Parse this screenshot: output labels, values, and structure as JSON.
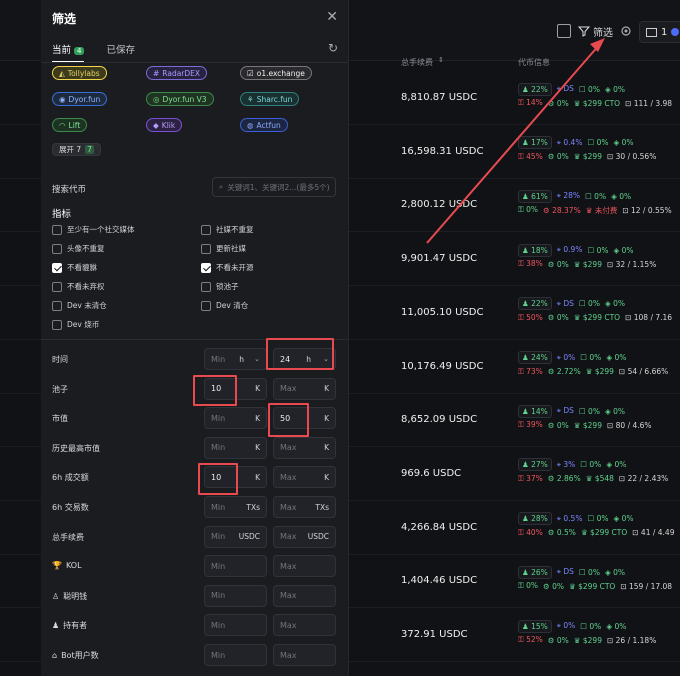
{
  "topbar": {
    "filter_label": "筛选",
    "folder_count": "1"
  },
  "table": {
    "col_fee": "总手续费",
    "col_info": "代币信息"
  },
  "rows": [
    {
      "fee": "8,810.87 USDC",
      "l1": [
        "22%",
        "DS",
        "0%",
        "0%"
      ],
      "l2": [
        "14%",
        "0%",
        "$299 CTO",
        "111 / 3.98"
      ]
    },
    {
      "fee": "16,598.31 USDC",
      "l1": [
        "17%",
        "0.4%",
        "0%",
        "0%"
      ],
      "l2": [
        "45%",
        "0%",
        "$299",
        "30 / 0.56%"
      ]
    },
    {
      "fee": "2,800.12 USDC",
      "l1": [
        "61%",
        "28%",
        "0%",
        "0%"
      ],
      "l2": [
        "0%",
        "28.37%",
        "未付费",
        "12 / 0.55%"
      ]
    },
    {
      "fee": "9,901.47 USDC",
      "l1": [
        "18%",
        "0.9%",
        "0%",
        "0%"
      ],
      "l2": [
        "38%",
        "0%",
        "$299",
        "32 / 1.15%"
      ]
    },
    {
      "fee": "11,005.10 USDC",
      "l1": [
        "22%",
        "DS",
        "0%",
        "0%"
      ],
      "l2": [
        "50%",
        "0%",
        "$299 CTO",
        "108 / 7.16"
      ]
    },
    {
      "fee": "10,176.49 USDC",
      "l1": [
        "24%",
        "0%",
        "0%",
        "0%"
      ],
      "l2": [
        "73%",
        "2.72%",
        "$299",
        "54 / 6.66%"
      ]
    },
    {
      "fee": "8,652.09 USDC",
      "l1": [
        "14%",
        "DS",
        "0%",
        "0%"
      ],
      "l2": [
        "39%",
        "0%",
        "$299",
        "80 / 4.6%"
      ]
    },
    {
      "fee": "969.6 USDC",
      "l1": [
        "27%",
        "3%",
        "0%",
        "0%"
      ],
      "l2": [
        "37%",
        "2.86%",
        "$548",
        "22 / 2.43%"
      ]
    },
    {
      "fee": "4,266.84 USDC",
      "l1": [
        "28%",
        "0.5%",
        "0%",
        "0%"
      ],
      "l2": [
        "40%",
        "0.5%",
        "$299 CTO",
        "41 / 4.49"
      ]
    },
    {
      "fee": "1,404.46 USDC",
      "l1": [
        "26%",
        "DS",
        "0%",
        "0%"
      ],
      "l2": [
        "0%",
        "0%",
        "$299 CTO",
        "159 / 17.08"
      ]
    },
    {
      "fee": "372.91 USDC",
      "l1": [
        "15%",
        "0%",
        "0%",
        "0%"
      ],
      "l2": [
        "52%",
        "0%",
        "$299",
        "26 / 1.18%"
      ]
    }
  ],
  "panel": {
    "title": "筛选",
    "tab_current": "当前",
    "tab_current_count": "4",
    "tab_saved": "已保存",
    "sources": [
      "Tollylabs",
      "RadarDEX",
      "o1.exchange",
      "Dyor.fun",
      "Dyor.fun V3",
      "Sharc.fun",
      "Lift",
      "Klik",
      "Actfun"
    ],
    "expand_label": "展开 7",
    "expand_count": "7",
    "search_label": "搜索代币",
    "search_placeholder": "关键词1、关键词2...(最多5个)",
    "indicators_label": "指标",
    "checks": [
      {
        "label": "至少有一个社交媒体",
        "on": false
      },
      {
        "label": "社媒不重复",
        "on": false
      },
      {
        "label": "头像不重复",
        "on": false
      },
      {
        "label": "更新社媒",
        "on": false
      },
      {
        "label": "不看貔貅",
        "on": true
      },
      {
        "label": "不看未开源",
        "on": true
      },
      {
        "label": "不看未弃权",
        "on": false
      },
      {
        "label": "锁池子",
        "on": false
      },
      {
        "label": "Dev 未清仓",
        "on": false
      },
      {
        "label": "Dev 清仓",
        "on": false
      },
      {
        "label": "Dev 烧币",
        "on": false
      }
    ],
    "filters": [
      {
        "label": "时间",
        "min": "Min",
        "min_unit": "h",
        "max": "24",
        "max_unit": "h"
      },
      {
        "label": "池子",
        "min": "10",
        "min_unit": "K",
        "max": "Max",
        "max_unit": "K"
      },
      {
        "label": "市值",
        "min": "Min",
        "min_unit": "K",
        "max": "50",
        "max_unit": "K"
      },
      {
        "label": "历史最高市值",
        "min": "Min",
        "min_unit": "K",
        "max": "Max",
        "max_unit": "K"
      },
      {
        "label": "6h 成交额",
        "min": "10",
        "min_unit": "K",
        "max": "Max",
        "max_unit": "K"
      },
      {
        "label": "6h 交易数",
        "min": "Min",
        "min_unit": "TXs",
        "max": "Max",
        "max_unit": "TXs"
      },
      {
        "label": "总手续费",
        "min": "Min",
        "min_unit": "USDC",
        "max": "Max",
        "max_unit": "USDC"
      },
      {
        "label": "KOL",
        "min": "Min",
        "min_unit": "",
        "max": "Max",
        "max_unit": ""
      },
      {
        "label": "聪明钱",
        "min": "Min",
        "min_unit": "",
        "max": "Max",
        "max_unit": ""
      },
      {
        "label": "持有者",
        "min": "Min",
        "min_unit": "",
        "max": "Max",
        "max_unit": ""
      },
      {
        "label": "Bot用户数",
        "min": "Min",
        "min_unit": "",
        "max": "Max",
        "max_unit": ""
      }
    ]
  },
  "colors": {
    "highlight": "#e84a4f",
    "green": "#5fd38f",
    "red": "#f0555e"
  }
}
